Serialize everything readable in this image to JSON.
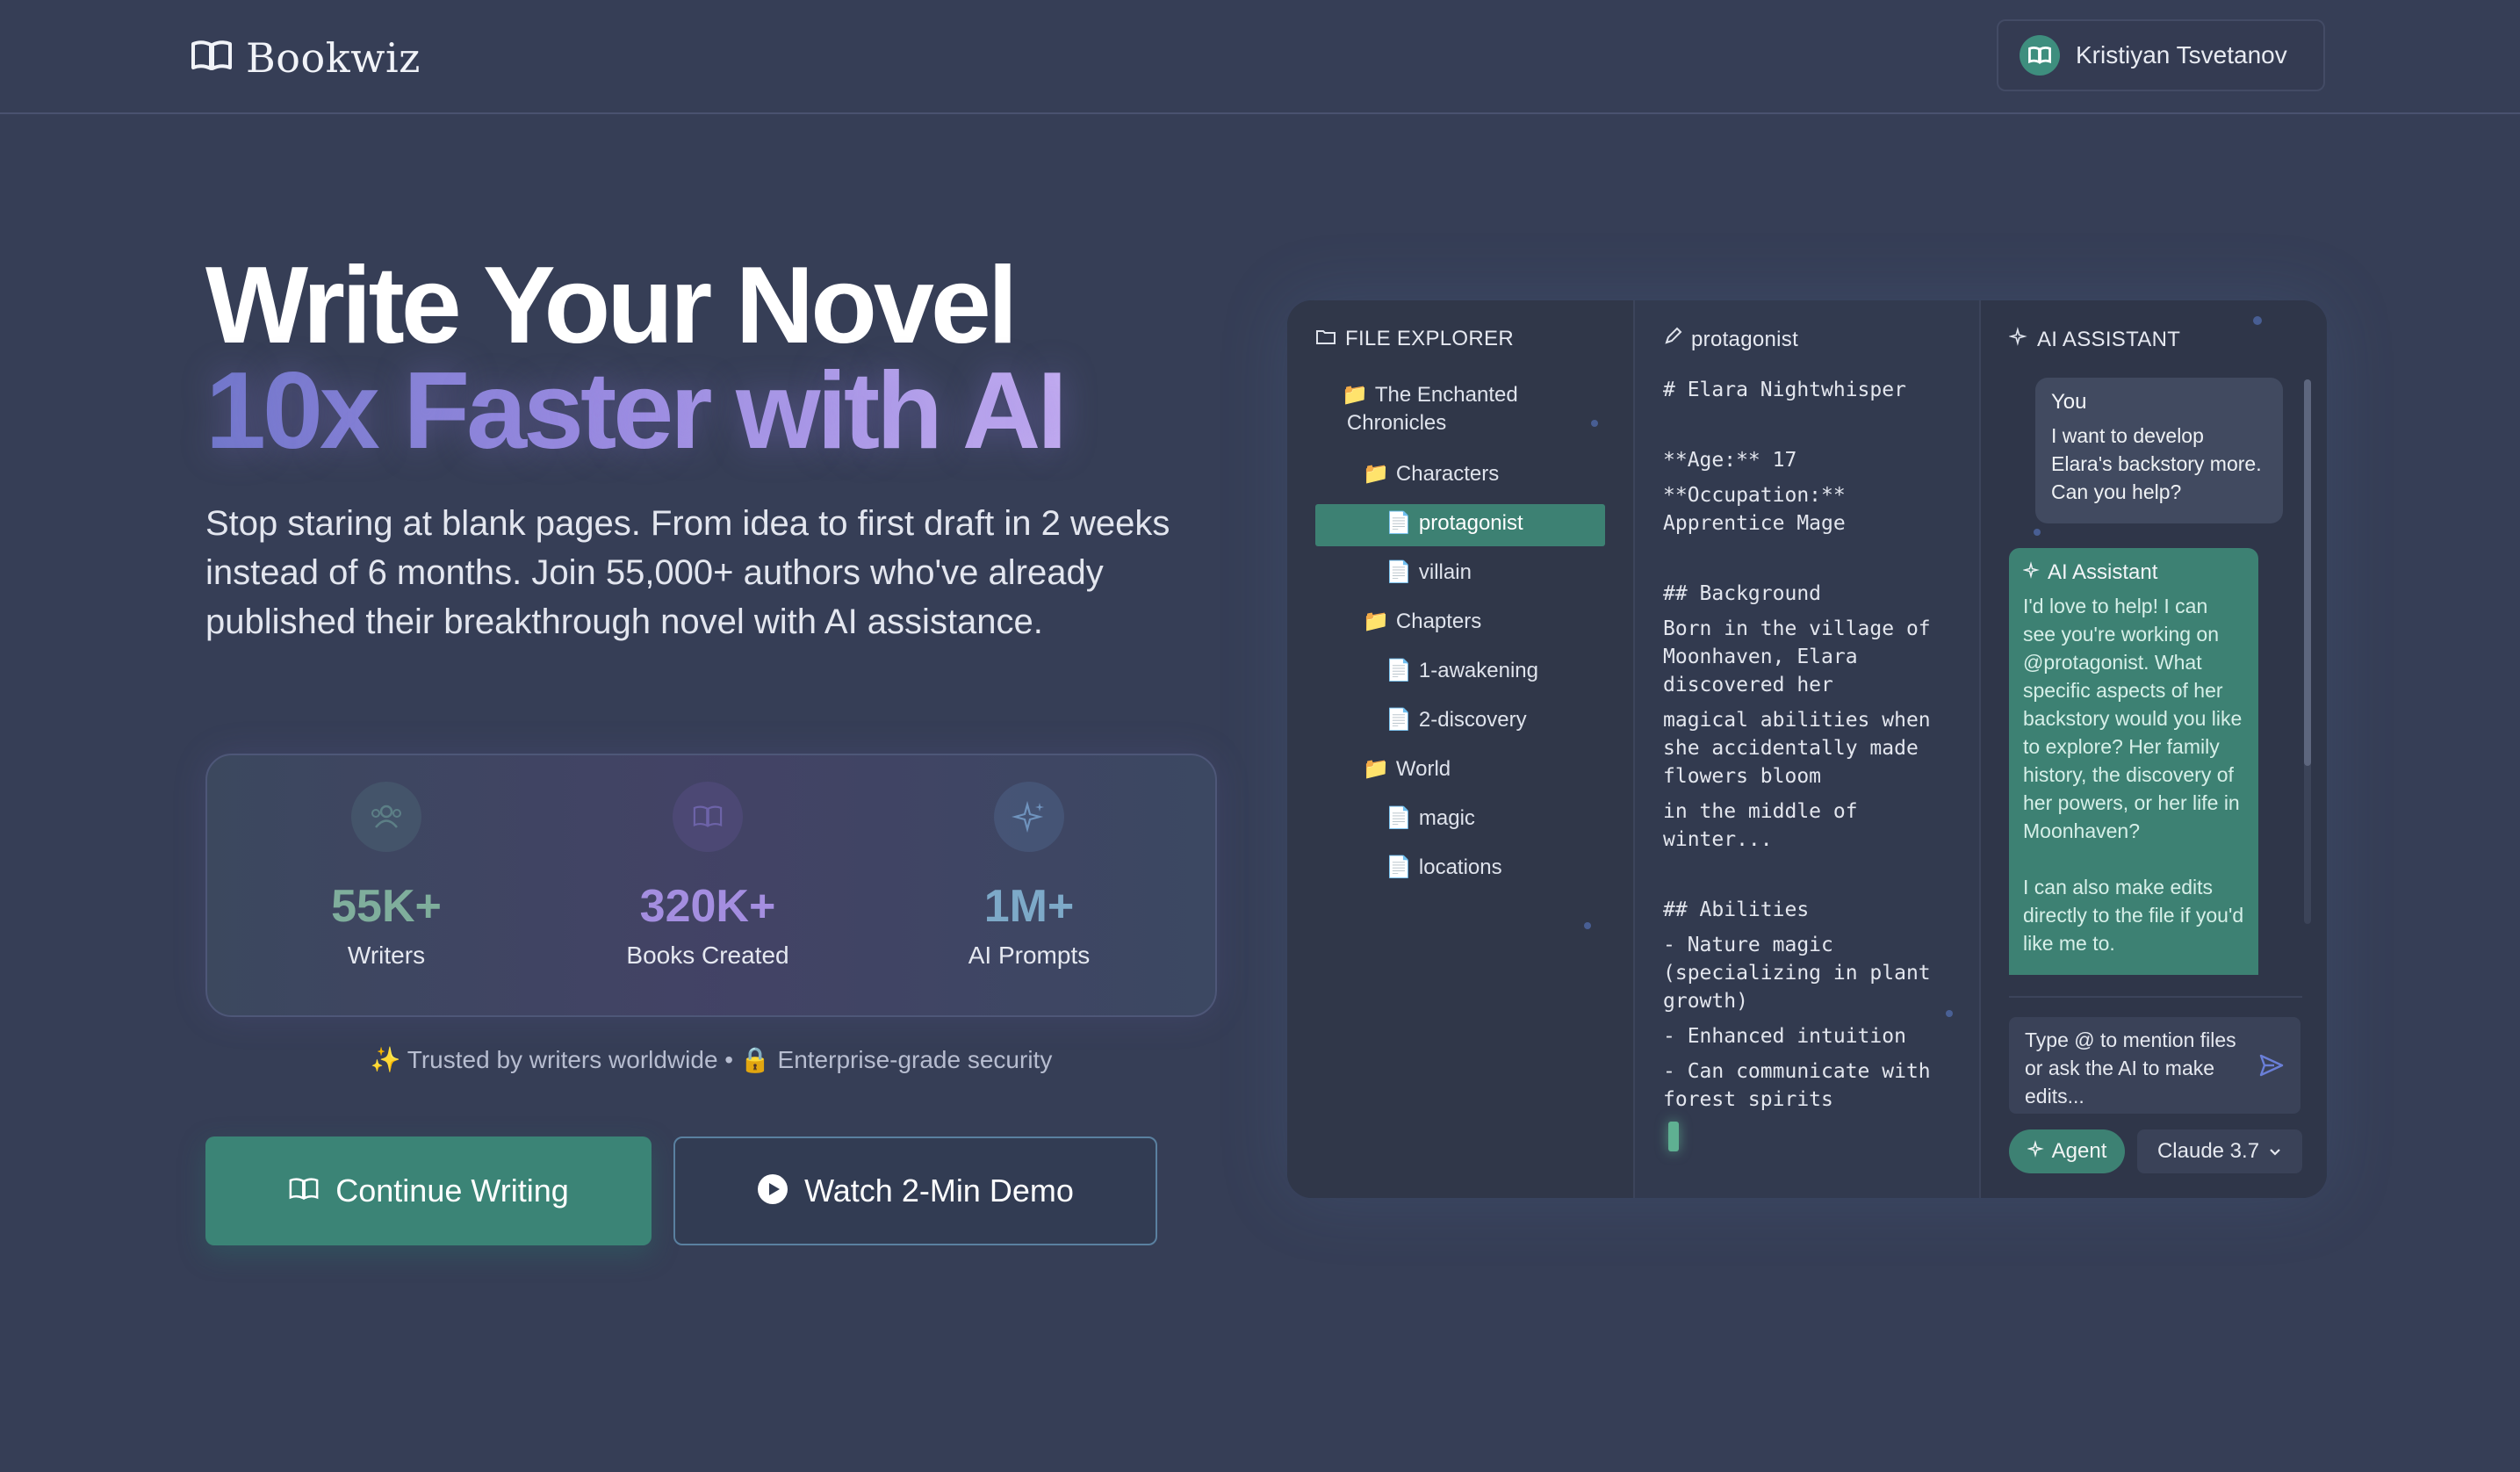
{
  "header": {
    "logo_text": "Bookwiz",
    "user_name": "Kristiyan Tsvetanov"
  },
  "hero": {
    "title_line1": "Write Your Novel",
    "title_line2": "10x Faster with AI",
    "subtitle": "Stop staring at blank pages. From idea to first draft in 2 weeks instead of 6 months. Join 55,000+ authors who've already published their breakthrough novel with AI assistance.",
    "trust_text": "✨ Trusted by writers worldwide • 🔒 Enterprise-grade security",
    "primary_button": "Continue Writing",
    "secondary_button": "Watch 2-Min Demo"
  },
  "stats": [
    {
      "value": "55K+",
      "label": "Writers",
      "icon": "users-icon",
      "color": "#7fae9c"
    },
    {
      "value": "320K+",
      "label": "Books Created",
      "icon": "book-icon",
      "color": "#a48ee0"
    },
    {
      "value": "1M+",
      "label": "AI Prompts",
      "icon": "sparkles-icon",
      "color": "#7da9c8"
    }
  ],
  "app": {
    "file_explorer": {
      "title": "FILE EXPLORER",
      "items": [
        {
          "label": "The Enchanted",
          "label2": "Chronicles",
          "type": "folder"
        },
        {
          "label": "Characters",
          "type": "folder"
        },
        {
          "label": "protagonist",
          "type": "file",
          "selected": true
        },
        {
          "label": "villain",
          "type": "file"
        },
        {
          "label": "Chapters",
          "type": "folder"
        },
        {
          "label": "1-awakening",
          "type": "file"
        },
        {
          "label": "2-discovery",
          "type": "file"
        },
        {
          "label": "World",
          "type": "folder"
        },
        {
          "label": "magic",
          "type": "file"
        },
        {
          "label": "locations",
          "type": "file"
        }
      ]
    },
    "editor": {
      "title": "protagonist",
      "lines": [
        "# Elara Nightwhisper",
        "**Age:** 17",
        "**Occupation:**",
        "Apprentice Mage",
        "## Background",
        "Born in the village of",
        "Moonhaven, Elara",
        "discovered her",
        "magical abilities when",
        "she accidentally made",
        "flowers bloom",
        "in the middle of",
        "winter...",
        "## Abilities",
        "- Nature magic",
        "(specializing in plant",
        "growth)",
        "- Enhanced intuition",
        "- Can communicate with",
        "forest spirits"
      ]
    },
    "assistant": {
      "title": "AI ASSISTANT",
      "user_name": "You",
      "user_message": "I want to develop Elara's backstory more. Can you help?",
      "ai_name": "AI Assistant",
      "ai_message": "I'd love to help! I can see you're working on @protagonist. What specific aspects of her backstory would you like to explore? Her family history, the discovery of her powers, or her life in Moonhaven?",
      "ai_message_2": "I can also make edits directly to the file if you'd like me to.",
      "input_placeholder": "Type @ to mention files or ask the AI to make edits...",
      "agent_label": "Agent",
      "model_label": "Claude 3.7"
    }
  }
}
